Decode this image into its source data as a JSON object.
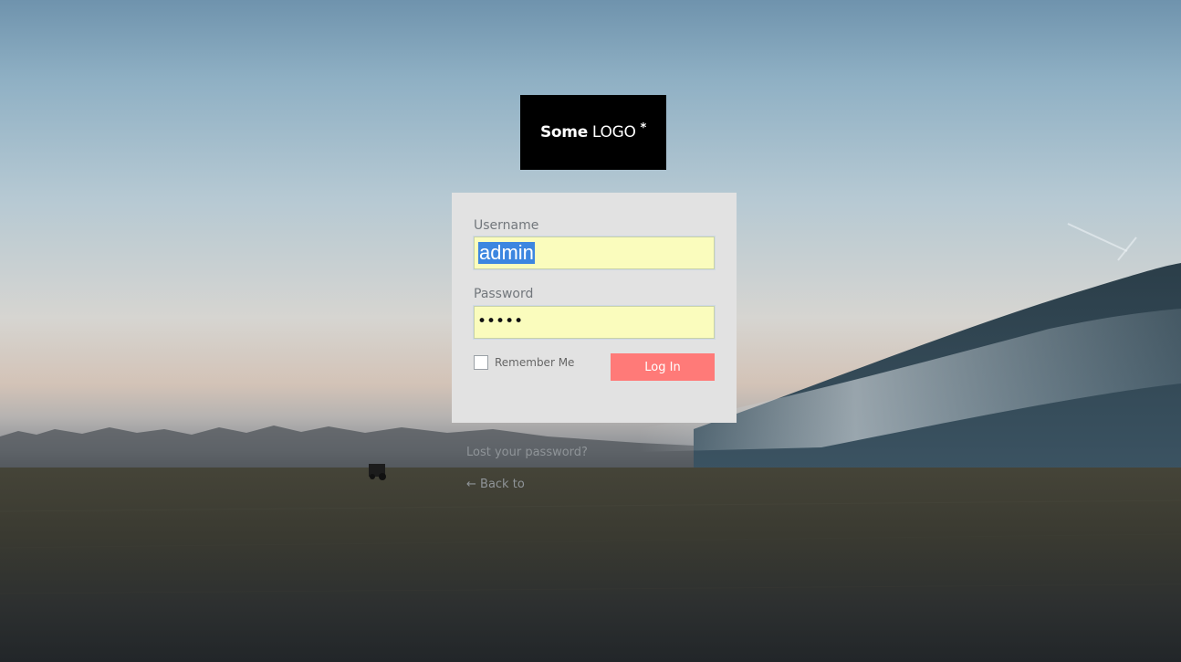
{
  "logo": {
    "bold_text": "Some",
    "light_text": "LOGO",
    "mark": "*"
  },
  "login_form": {
    "username_label": "Username",
    "username_value": "admin",
    "password_label": "Password",
    "password_value": "•••••",
    "remember_label": "Remember Me",
    "remember_checked": false,
    "submit_label": "Log In"
  },
  "links": {
    "lost_password": "Lost your password?",
    "back_to": "← Back to"
  },
  "colors": {
    "button": "#ff7a78",
    "form_bg": "#e2e2e2",
    "autofill": "#fafcbd",
    "logo_bg": "#000000"
  }
}
